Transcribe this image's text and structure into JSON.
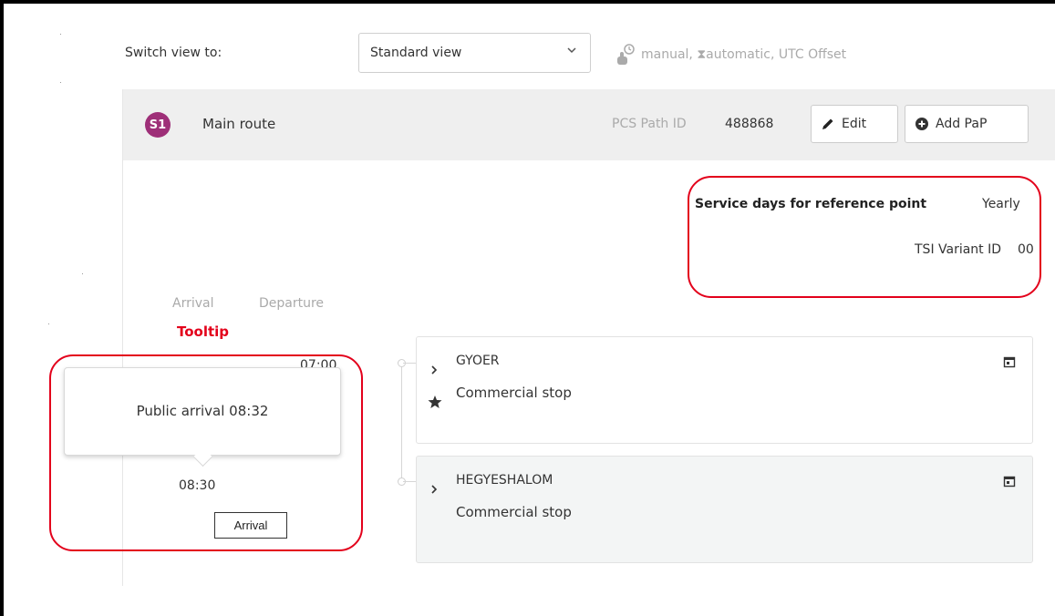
{
  "toolbar": {
    "switch_label": "Switch view to:",
    "view_select_value": "Standard view",
    "legend_text": "manual, ⧗automatic, UTC Offset",
    "legend_icon": "hand-clock-icon"
  },
  "route": {
    "badge": "S1",
    "badge_color": "#9e2f78",
    "name": "Main route",
    "pcs_label": "PCS Path ID",
    "pcs_value": "488868",
    "edit_label": "Edit",
    "add_pap_label": "Add PaP"
  },
  "info": {
    "service_days_label": "Service days for reference point",
    "service_days_value": "Yearly",
    "tsi_label": "TSI Variant ID",
    "tsi_value": "00"
  },
  "columns": {
    "arrival": "Arrival",
    "departure": "Departure"
  },
  "annotation": {
    "tooltip_caption": "Tooltip",
    "color": "#e3001b"
  },
  "times": {
    "first_departure": "07:00",
    "second_arrival": "08:30"
  },
  "tooltip": {
    "text": "Public arrival  08:32",
    "small_text": "Arrival"
  },
  "stops": [
    {
      "name": "GYOER",
      "type": "Commercial stop"
    },
    {
      "name": "HEGYESHALOM",
      "type": "Commercial stop"
    }
  ]
}
